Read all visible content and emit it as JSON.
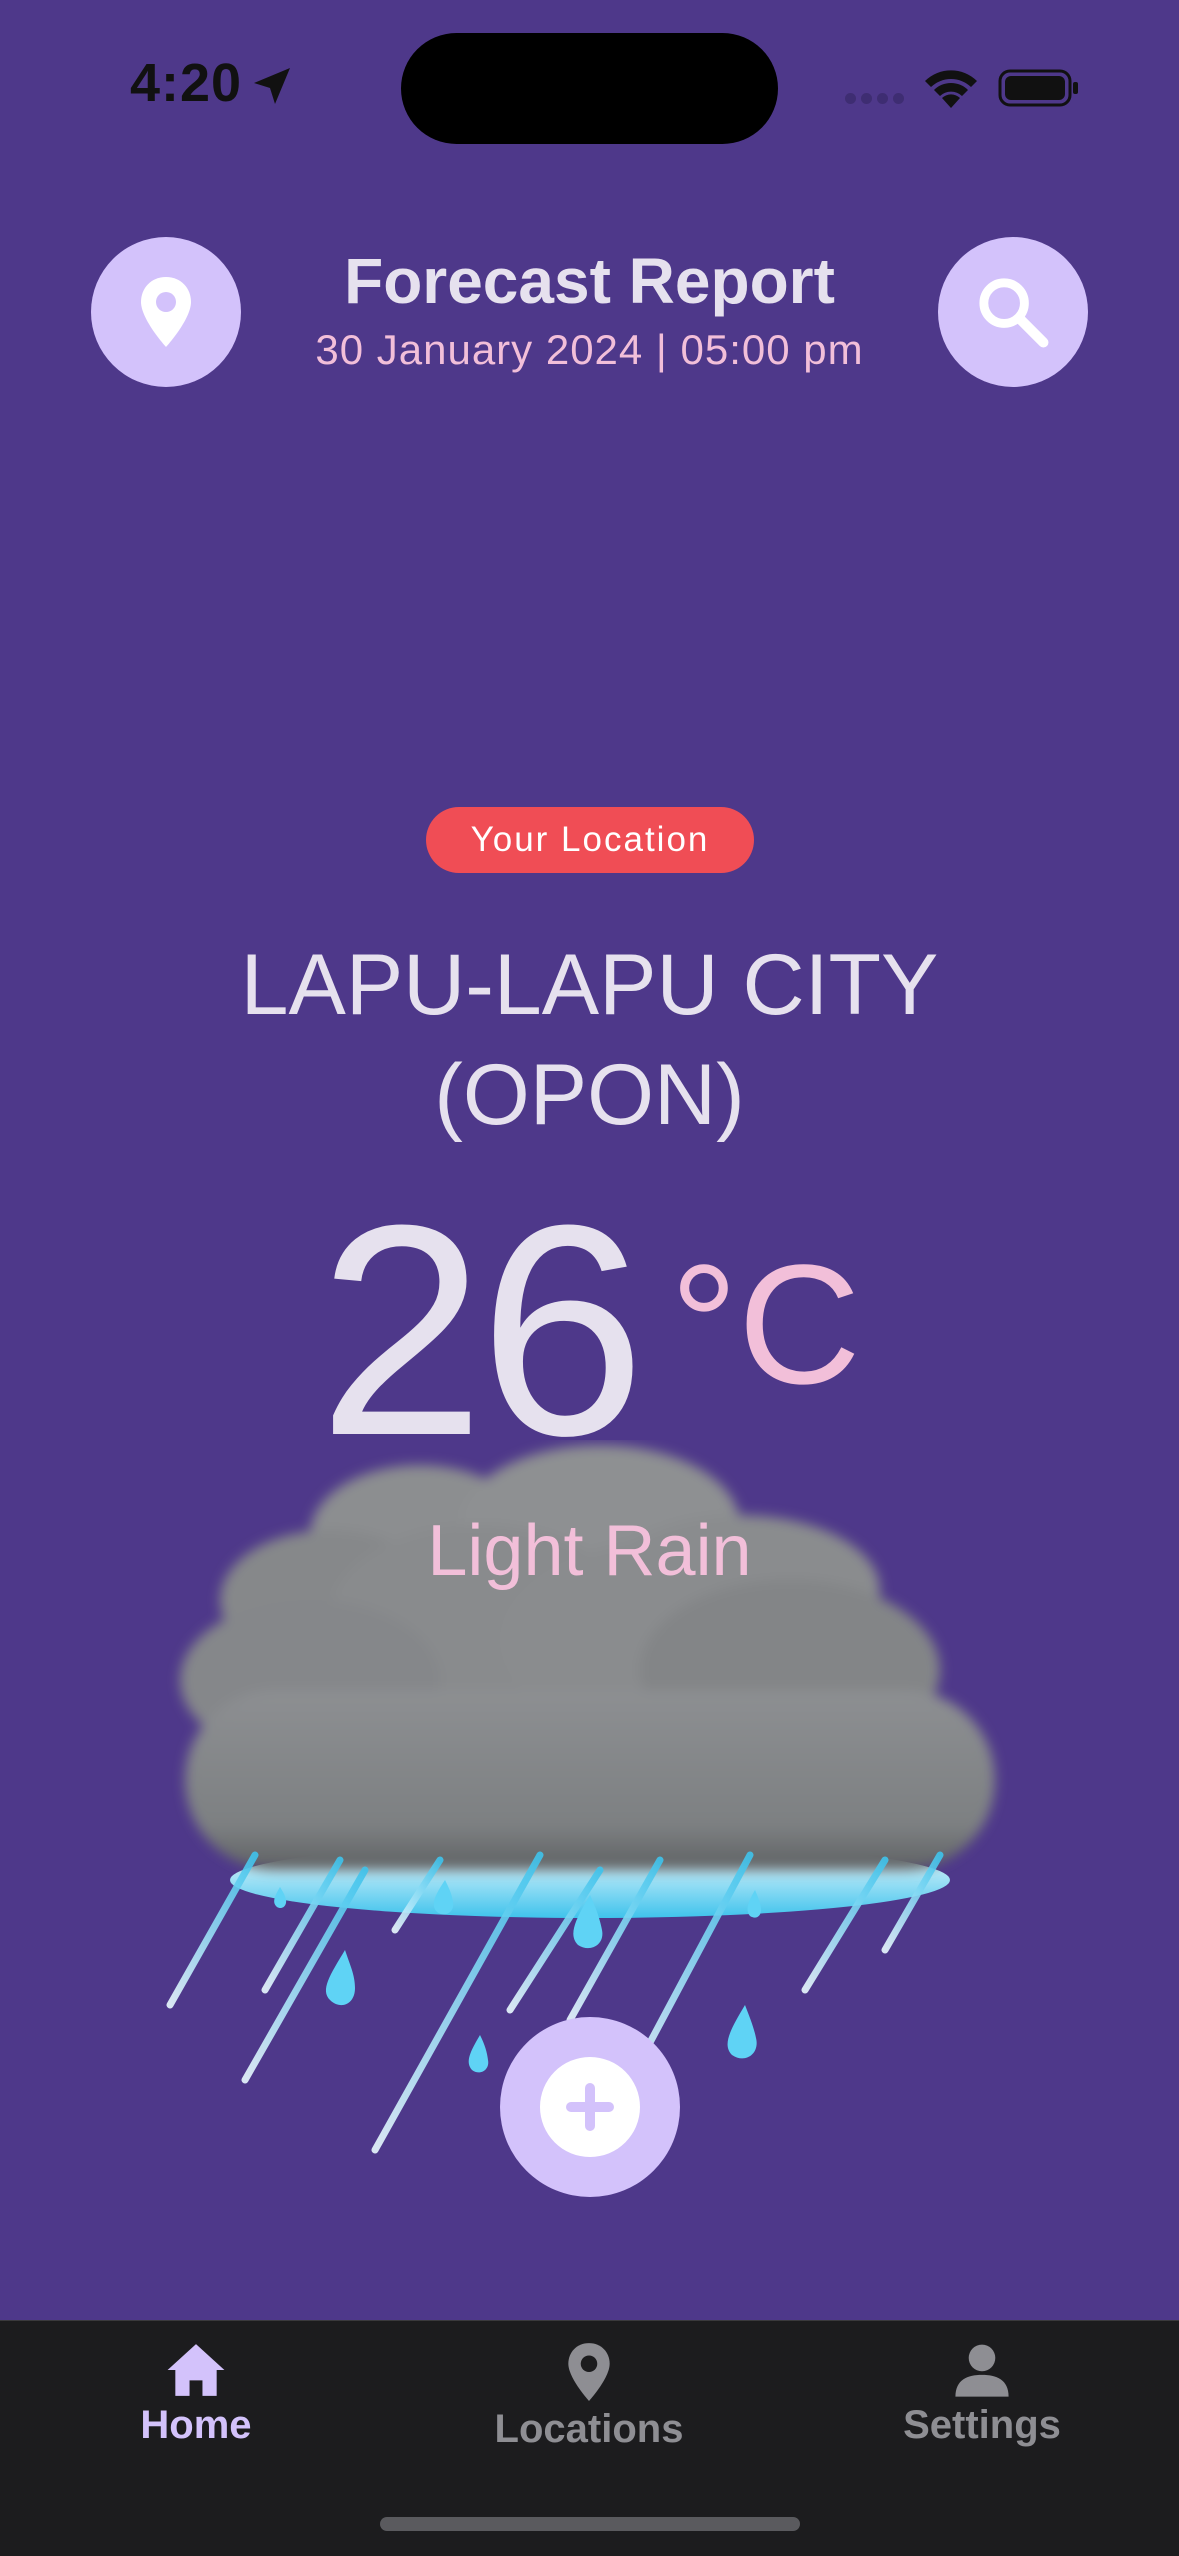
{
  "status_bar": {
    "time": "4:20",
    "icons": [
      "location-arrow-icon",
      "cellular-signal-icon",
      "wifi-icon",
      "battery-icon"
    ]
  },
  "header": {
    "title": "Forecast Report",
    "subtitle": "30 January 2024 | 05:00 pm",
    "left_icon": "location-pin-icon",
    "right_icon": "search-icon"
  },
  "weather": {
    "badge": "Your Location",
    "city_line1": "LAPU-LAPU CITY",
    "city_line2": "(OPON)",
    "temperature": "26",
    "unit": "°C",
    "condition": "Light Rain",
    "illustration": "rain-cloud-icon"
  },
  "add_button": {
    "icon": "plus-icon"
  },
  "tabs": [
    {
      "label": "Home",
      "icon": "home-icon",
      "active": true
    },
    {
      "label": "Locations",
      "icon": "location-pin-icon",
      "active": false
    },
    {
      "label": "Settings",
      "icon": "person-icon",
      "active": false
    }
  ],
  "colors": {
    "background": "#4e388a",
    "accent": "#d3c2fb",
    "pink_text": "#f2bfd9",
    "badge": "#f04d55",
    "tabbar": "#1c1c1e"
  }
}
